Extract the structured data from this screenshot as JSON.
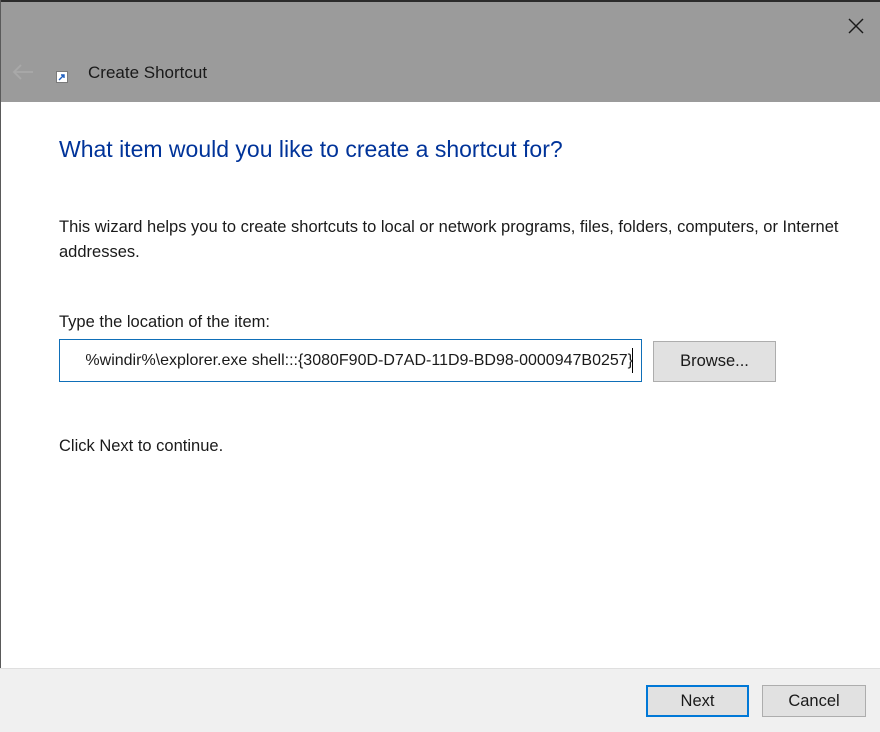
{
  "window": {
    "title": "Create Shortcut",
    "close_icon": "close-icon",
    "back_icon": "back-arrow-icon",
    "app_icon": "shortcut-icon"
  },
  "content": {
    "heading": "What item would you like to create a shortcut for?",
    "description": "This wizard helps you to create shortcuts to local or network programs, files, folders, computers, or Internet addresses.",
    "location_label": "Type the location of the item:",
    "location_value": "%windir%\\explorer.exe shell:::{3080F90D-D7AD-11D9-BD98-0000947B0257}",
    "browse_label": "Browse...",
    "continue_text": "Click Next to continue."
  },
  "footer": {
    "next_label": "Next",
    "cancel_label": "Cancel"
  },
  "colors": {
    "heading": "#003399",
    "title_bar": "#9b9b9b",
    "input_border": "#0f6fb8",
    "focus_border": "#0078d7",
    "button_bg": "#e1e1e1",
    "footer_bg": "#f0f0f0"
  }
}
